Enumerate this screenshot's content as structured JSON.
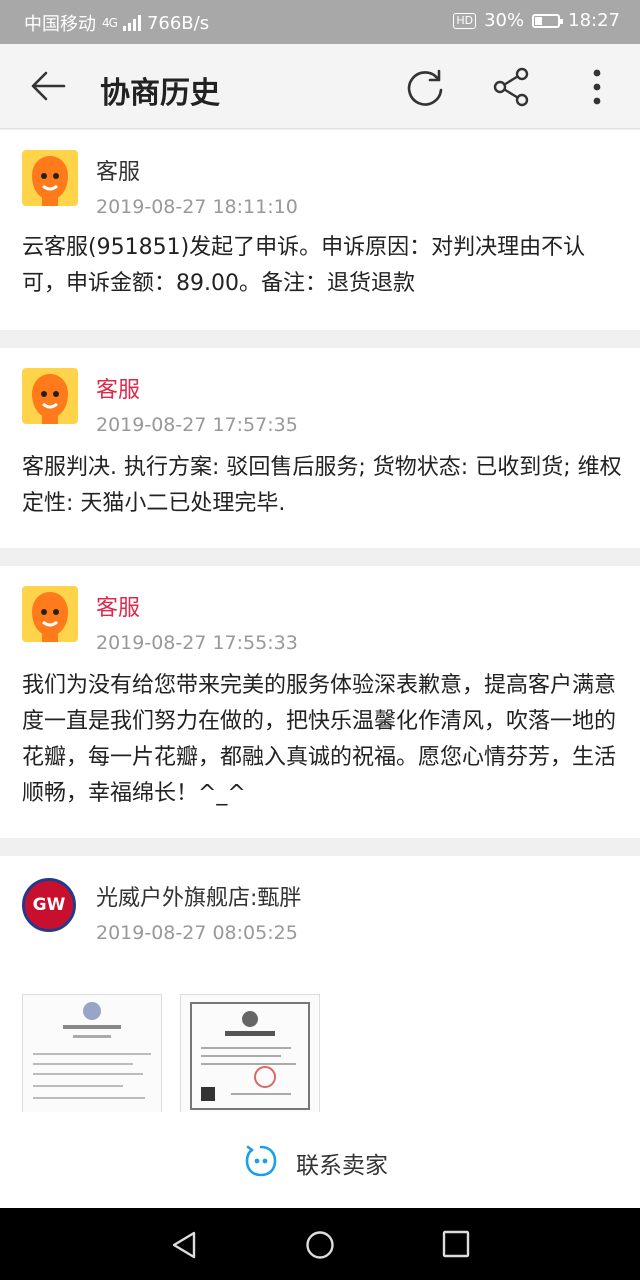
{
  "status_bar": {
    "carrier": "中国移动",
    "network": "4G",
    "speed": "766B/s",
    "hd": "HD",
    "battery": "30%",
    "battery_level": 0.3,
    "time": "18:27"
  },
  "app_bar": {
    "title": "协商历史"
  },
  "messages": [
    {
      "sender": "客服",
      "time": "2019-08-27 18:11:10",
      "text": "云客服(951851)发起了申诉。申诉原因：对判决理由不认可，申诉金额：89.00。备注：退货退款"
    },
    {
      "sender": "客服",
      "time": "2019-08-27 17:57:35",
      "text": "客服判决. 执行方案: 驳回售后服务; 货物状态: 已收到货; 维权定性: 天猫小二已处理完毕."
    },
    {
      "sender": "客服",
      "time": "2019-08-27 17:55:33",
      "text": "我们为没有给您带来完美的服务体验深表歉意，提高客户满意度一直是我们努力在做的，把快乐温馨化作清风，吹落一地的花瓣，每一片花瓣，都融入真诚的祝福。愿您心情芬芳，生活顺畅，幸福绵长！^_^"
    },
    {
      "sender": "光威户外旗舰店:甄胖",
      "time": "2019-08-27 08:05:25",
      "logo": "GW"
    }
  ],
  "bottom": {
    "contact_label": "联系卖家"
  },
  "colors": {
    "accent_red": "#e0284a",
    "status_bar": "#a8a8a8",
    "contact_icon": "#1aa0e8"
  }
}
